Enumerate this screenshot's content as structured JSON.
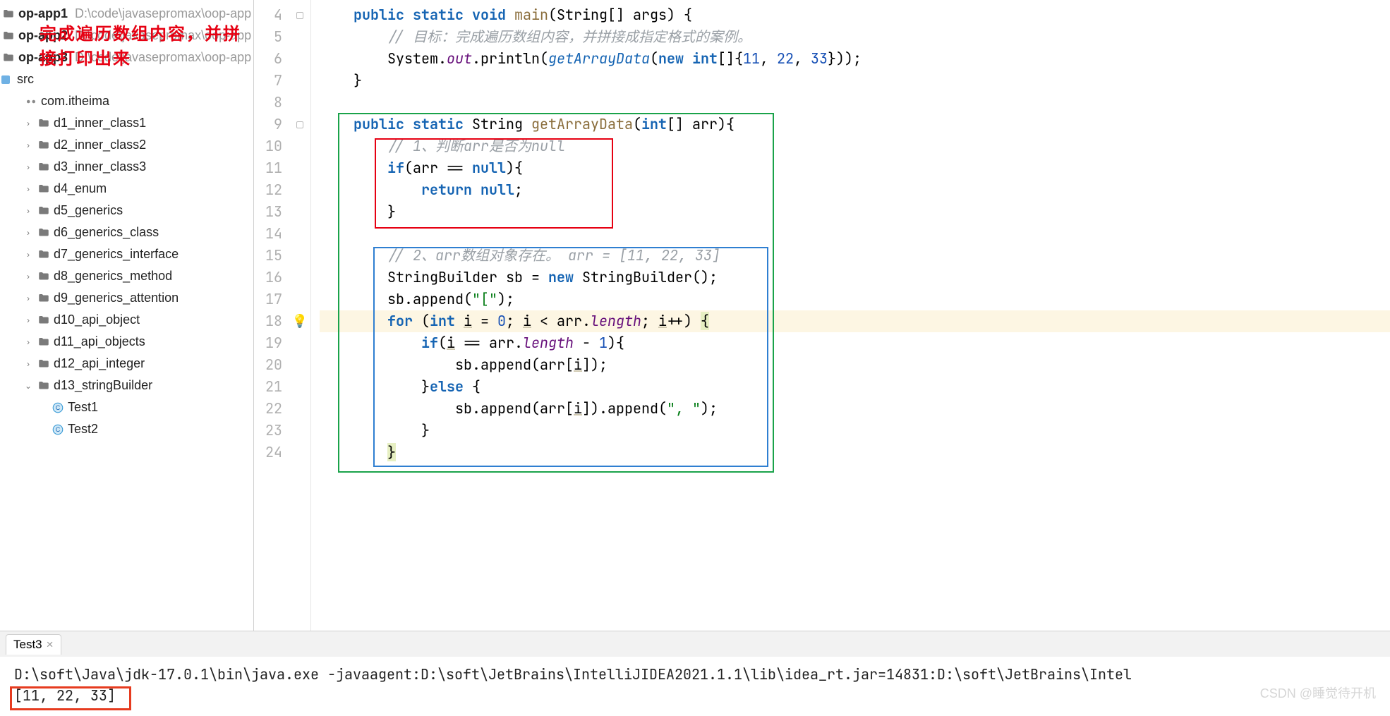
{
  "annotation_overlay": "完成遍历数组内容，并拼接打印出来",
  "tree": {
    "modules": [
      {
        "name": "op-app1",
        "path": "D:\\code\\javasepromax\\oop-app"
      },
      {
        "name": "op-app2",
        "path": "D:\\code\\javasepromax\\oop-app"
      },
      {
        "name": "op-app3",
        "path": "D:\\code\\javasepromax\\oop-app"
      }
    ],
    "src_label": "src",
    "pkg_label": "com.itheima",
    "folders": [
      "d1_inner_class1",
      "d2_inner_class2",
      "d3_inner_class3",
      "d4_enum",
      "d5_generics",
      "d6_generics_class",
      "d7_generics_interface",
      "d8_generics_method",
      "d9_generics_attention",
      "d10_api_object",
      "d11_api_objects",
      "d12_api_integer",
      "d13_stringBuilder"
    ],
    "open_folder_children": [
      "Test1",
      "Test2"
    ]
  },
  "editor": {
    "first_line_no": 4,
    "lines": [
      {
        "n": 4,
        "tokens": [
          [
            "",
            "    "
          ],
          [
            "kw",
            "public"
          ],
          [
            "",
            " "
          ],
          [
            "kw",
            "static"
          ],
          [
            "",
            " "
          ],
          [
            "kw",
            "void"
          ],
          [
            "",
            " "
          ],
          [
            "fn",
            "main"
          ],
          [
            "",
            "(String[] args) {"
          ]
        ]
      },
      {
        "n": 5,
        "tokens": [
          [
            "",
            "        "
          ],
          [
            "cmt",
            "// 目标：完成遍历数组内容，并拼接成指定格式的案例。"
          ]
        ]
      },
      {
        "n": 6,
        "tokens": [
          [
            "",
            "        System."
          ],
          [
            "fld",
            "out"
          ],
          [
            "",
            ".println("
          ],
          [
            "sfn",
            "getArrayData"
          ],
          [
            "",
            "("
          ],
          [
            "kw",
            "new"
          ],
          [
            "",
            " "
          ],
          [
            "kw",
            "int"
          ],
          [
            "",
            "[]{"
          ],
          [
            "num",
            "11"
          ],
          [
            "",
            ", "
          ],
          [
            "num",
            "22"
          ],
          [
            "",
            ", "
          ],
          [
            "num",
            "33"
          ],
          [
            "",
            "}));"
          ]
        ]
      },
      {
        "n": 7,
        "tokens": [
          [
            "",
            "    }"
          ]
        ]
      },
      {
        "n": 8,
        "tokens": [
          [
            "",
            ""
          ]
        ]
      },
      {
        "n": 9,
        "tokens": [
          [
            "",
            "    "
          ],
          [
            "kw",
            "public"
          ],
          [
            "",
            " "
          ],
          [
            "kw",
            "static"
          ],
          [
            "",
            " String "
          ],
          [
            "fn",
            "getArrayData"
          ],
          [
            "",
            "("
          ],
          [
            "kw",
            "int"
          ],
          [
            "",
            "[] arr){"
          ]
        ]
      },
      {
        "n": 10,
        "tokens": [
          [
            "",
            "        "
          ],
          [
            "cmt",
            "// 1、判断arr是否为null"
          ]
        ]
      },
      {
        "n": 11,
        "tokens": [
          [
            "",
            "        "
          ],
          [
            "kw",
            "if"
          ],
          [
            "",
            "(arr == "
          ],
          [
            "kw",
            "null"
          ],
          [
            "",
            "){"
          ]
        ]
      },
      {
        "n": 12,
        "tokens": [
          [
            "",
            "            "
          ],
          [
            "kw",
            "return"
          ],
          [
            "",
            " "
          ],
          [
            "kw",
            "null"
          ],
          [
            "",
            ";"
          ]
        ]
      },
      {
        "n": 13,
        "tokens": [
          [
            "",
            "        }"
          ]
        ]
      },
      {
        "n": 14,
        "tokens": [
          [
            "",
            ""
          ]
        ]
      },
      {
        "n": 15,
        "tokens": [
          [
            "",
            "        "
          ],
          [
            "cmt",
            "// 2、arr数组对象存在。 arr = [11, 22, 33]"
          ]
        ]
      },
      {
        "n": 16,
        "tokens": [
          [
            "",
            "        StringBuilder sb = "
          ],
          [
            "kw",
            "new"
          ],
          [
            "",
            " StringBuilder();"
          ]
        ]
      },
      {
        "n": 17,
        "tokens": [
          [
            "",
            "        sb.append("
          ],
          [
            "str",
            "\"[\""
          ],
          [
            "",
            ");"
          ]
        ]
      },
      {
        "n": 18,
        "hl": true,
        "tokens": [
          [
            "",
            "        "
          ],
          [
            "kw",
            "for"
          ],
          [
            "",
            " ("
          ],
          [
            "kw",
            "int"
          ],
          [
            "",
            " "
          ],
          [
            "var",
            "i"
          ],
          [
            "",
            " = "
          ],
          [
            "num",
            "0"
          ],
          [
            "",
            "; "
          ],
          [
            "var",
            "i"
          ],
          [
            "",
            " < arr."
          ],
          [
            "fld",
            "length"
          ],
          [
            "",
            "; "
          ],
          [
            "var",
            "i"
          ],
          [
            "",
            "++) "
          ],
          [
            "caret",
            "{"
          ]
        ]
      },
      {
        "n": 19,
        "tokens": [
          [
            "",
            "            "
          ],
          [
            "kw",
            "if"
          ],
          [
            "",
            "("
          ],
          [
            "var",
            "i"
          ],
          [
            "",
            " == arr."
          ],
          [
            "fld",
            "length"
          ],
          [
            "",
            " - "
          ],
          [
            "num",
            "1"
          ],
          [
            "",
            "){"
          ]
        ]
      },
      {
        "n": 20,
        "tokens": [
          [
            "",
            "                sb.append(arr["
          ],
          [
            "var",
            "i"
          ],
          [
            "",
            "]);"
          ]
        ]
      },
      {
        "n": 21,
        "tokens": [
          [
            "",
            "            }"
          ],
          [
            "kw",
            "else"
          ],
          [
            "",
            " {"
          ]
        ]
      },
      {
        "n": 22,
        "tokens": [
          [
            "",
            "                sb.append(arr["
          ],
          [
            "var",
            "i"
          ],
          [
            "",
            "]).append("
          ],
          [
            "str",
            "\", \""
          ],
          [
            "",
            ");"
          ]
        ]
      },
      {
        "n": 23,
        "tokens": [
          [
            "",
            "            }"
          ]
        ]
      },
      {
        "n": 24,
        "tokens": [
          [
            "",
            "        "
          ],
          [
            "caret",
            "}"
          ]
        ]
      }
    ]
  },
  "console": {
    "tab_label": "Test3",
    "lines": [
      "D:\\soft\\Java\\jdk-17.0.1\\bin\\java.exe -javaagent:D:\\soft\\JetBrains\\IntelliJIDEA2021.1.1\\lib\\idea_rt.jar=14831:D:\\soft\\JetBrains\\Intel",
      "[11, 22, 33]"
    ]
  },
  "watermark": "CSDN @睡觉待开机"
}
